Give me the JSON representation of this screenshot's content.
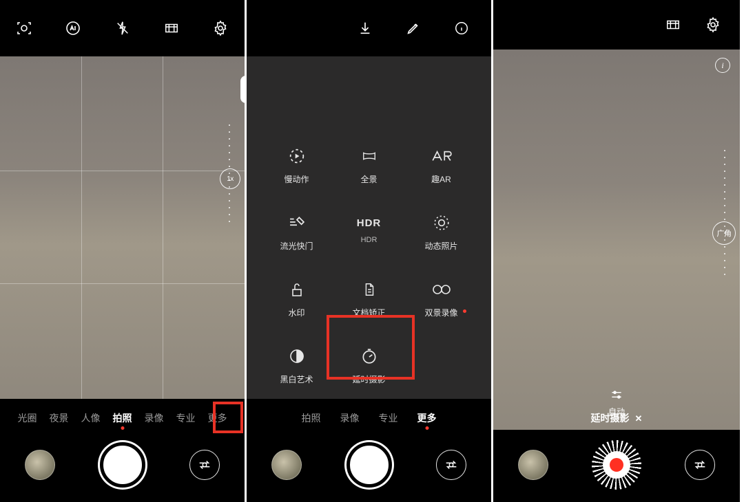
{
  "panel1": {
    "top_icons": [
      "motion-focus",
      "ai",
      "flash-off",
      "aspect-ratio",
      "settings"
    ],
    "zoom_label": "1x",
    "modes": [
      {
        "label": "光圈",
        "active": false
      },
      {
        "label": "夜景",
        "active": false
      },
      {
        "label": "人像",
        "active": false
      },
      {
        "label": "拍照",
        "active": true
      },
      {
        "label": "录像",
        "active": false
      },
      {
        "label": "专业",
        "active": false
      },
      {
        "label": "更多",
        "active": false,
        "highlighted": true
      }
    ]
  },
  "panel2": {
    "top_icons": [
      "download",
      "edit",
      "info"
    ],
    "more_items": [
      {
        "label": "慢动作",
        "icon": "slow-motion"
      },
      {
        "label": "全景",
        "icon": "panorama"
      },
      {
        "label": "趣AR",
        "icon": "ar"
      },
      {
        "label": "流光快门",
        "icon": "light-painting"
      },
      {
        "label": "HDR",
        "sub": "HDR",
        "icon": "hdr"
      },
      {
        "label": "动态照片",
        "icon": "live-photo"
      },
      {
        "label": "水印",
        "icon": "watermark"
      },
      {
        "label": "文档矫正",
        "icon": "document-scan"
      },
      {
        "label": "双景录像",
        "icon": "dual-view",
        "dot": true
      },
      {
        "label": "黑白艺术",
        "icon": "monochrome"
      },
      {
        "label": "延时摄影",
        "icon": "time-lapse",
        "highlighted": true
      }
    ],
    "modes": [
      {
        "label": "拍照",
        "active": false
      },
      {
        "label": "录像",
        "active": false
      },
      {
        "label": "专业",
        "active": false
      },
      {
        "label": "更多",
        "active": true
      }
    ]
  },
  "panel3": {
    "top_icons": [
      "aspect-ratio",
      "settings"
    ],
    "zoom_label": "广角",
    "auto_label": "自动",
    "mode_label": "延时摄影"
  }
}
